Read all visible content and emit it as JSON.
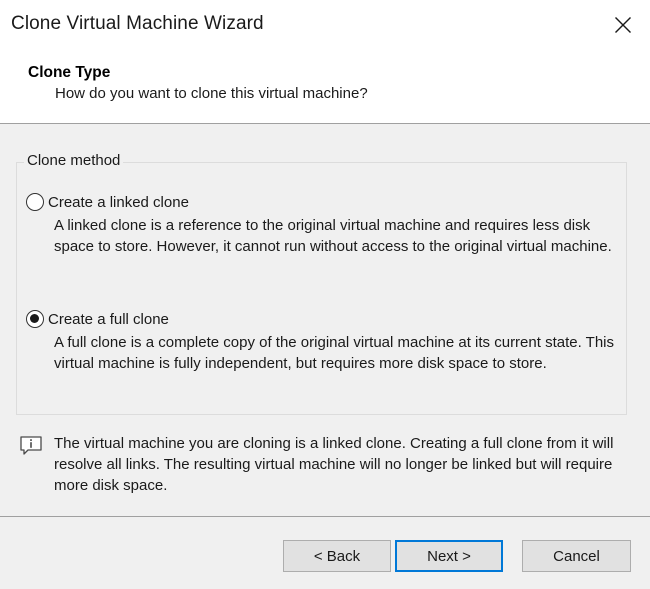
{
  "window": {
    "title": "Clone Virtual Machine Wizard",
    "close_icon": "close-icon"
  },
  "header": {
    "title": "Clone Type",
    "subtitle": "How do you want to clone this virtual machine?"
  },
  "clone_method": {
    "legend": "Clone method",
    "selected": "full",
    "options": [
      {
        "id": "linked",
        "label": "Create a linked clone",
        "description": "A linked clone is a reference to the original virtual machine and requires less disk space to store. However, it cannot run without access to the original virtual machine.",
        "checked": false
      },
      {
        "id": "full",
        "label": "Create a full clone",
        "description": "A full clone is a complete copy of the original virtual machine at its current state. This virtual machine is fully independent, but requires more disk space to store.",
        "checked": true
      }
    ]
  },
  "info": {
    "icon": "info-comment-icon",
    "text": "The virtual machine you are cloning is a linked clone. Creating a full clone from it will resolve all links. The resulting virtual machine will no longer be linked but will require more disk space."
  },
  "buttons": {
    "back": "< Back",
    "next": "Next >",
    "cancel": "Cancel",
    "default": "next"
  },
  "colors": {
    "content_bg": "#f0f0f0",
    "default_button_border": "#0078d7",
    "button_bg": "#e1e1e1"
  }
}
